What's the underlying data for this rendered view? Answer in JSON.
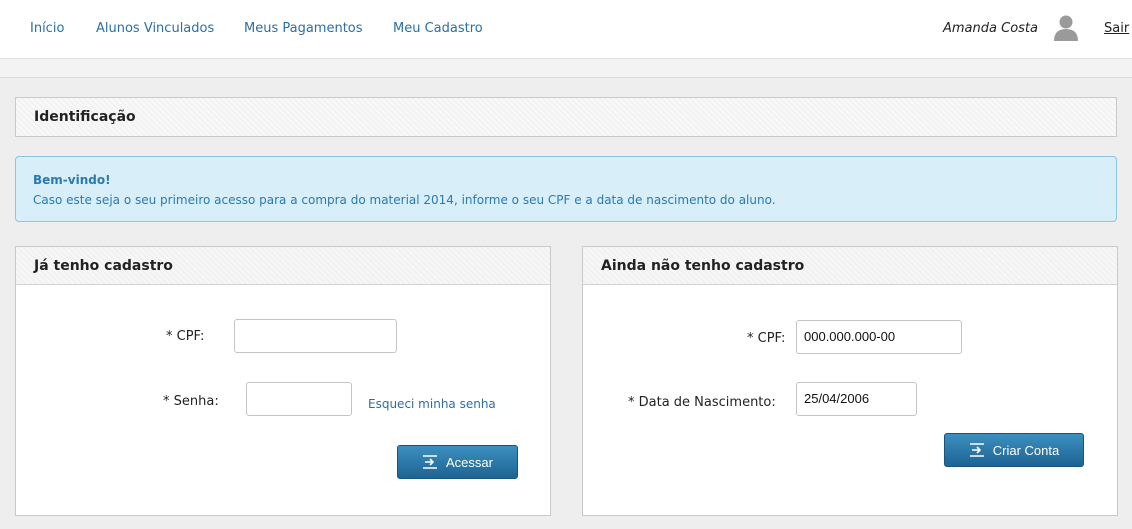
{
  "nav": {
    "items": [
      "Início",
      "Alunos Vinculados",
      "Meus Pagamentos",
      "Meu Cadastro"
    ],
    "user_name": "Amanda Costa",
    "logout": "Sair"
  },
  "identification": {
    "title": "Identificação"
  },
  "alert": {
    "heading": "Bem-vindo!",
    "message": "Caso este seja o seu primeiro acesso para a compra do material 2014, informe o seu CPF e a data de nascimento do aluno."
  },
  "login_panel": {
    "title": "Já tenho cadastro",
    "cpf_label": "* CPF:",
    "cpf_value": "",
    "password_label": "* Senha:",
    "password_value": "",
    "forgot_link": "Esqueci minha senha",
    "submit_label": "Acessar"
  },
  "register_panel": {
    "title": "Ainda não tenho cadastro",
    "cpf_label": "* CPF:",
    "cpf_value": "000.000.000-00",
    "birth_label": "* Data de Nascimento:",
    "birth_value": "25/04/2006",
    "submit_label": "Criar Conta"
  },
  "colors": {
    "link": "#2b6fa6",
    "button": "#1d6494",
    "alert_bg": "#d8eef8"
  },
  "icons": {
    "user": "user-icon",
    "submit": "enter-icon"
  }
}
